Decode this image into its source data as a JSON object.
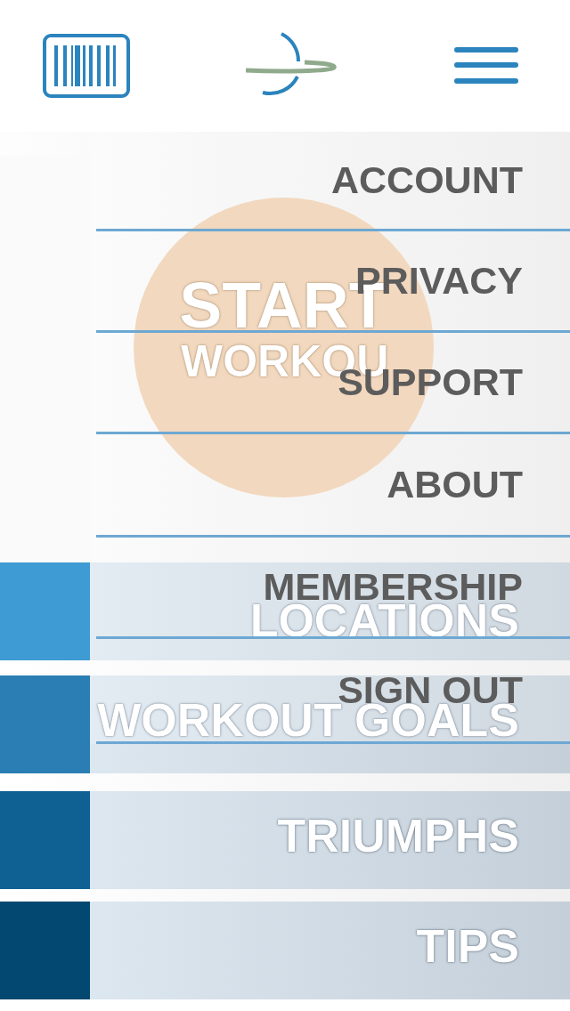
{
  "start_button": {
    "line_1": "START",
    "line_2": "WORKOU"
  },
  "nav_rows": [
    {
      "label": "LOCATIONS",
      "color": "#3f9bd3"
    },
    {
      "label": "WORKOUT GOALS",
      "color": "#2a7eb3"
    },
    {
      "label": "TRIUMPHS",
      "color": "#0f6193"
    },
    {
      "label": "TIPS",
      "color": "#034870"
    }
  ],
  "menu": {
    "items": [
      "ACCOUNT",
      "PRIVACY",
      "SUPPORT",
      "ABOUT",
      "MEMBERSHIP",
      "SIGN OUT"
    ]
  }
}
